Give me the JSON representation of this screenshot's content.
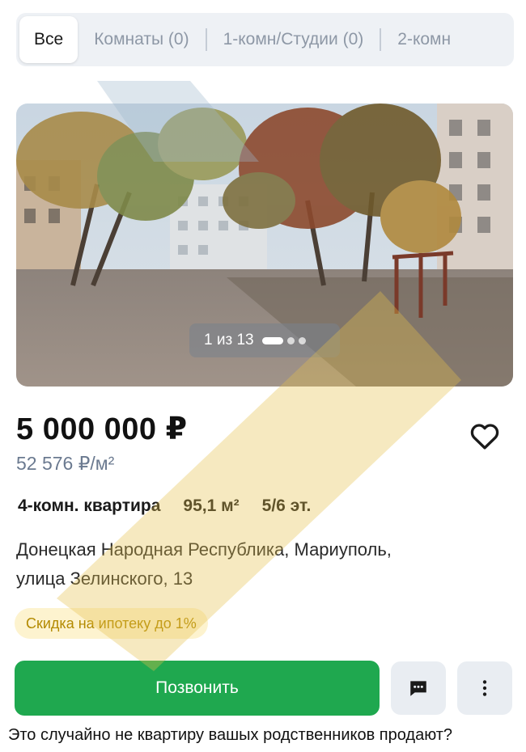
{
  "tabs": [
    {
      "label": "Все",
      "active": true
    },
    {
      "label": "Комнаты (0)",
      "active": false
    },
    {
      "label": "1-комн/Студии (0)",
      "active": false
    },
    {
      "label": "2-комн",
      "active": false
    }
  ],
  "photo": {
    "counter": "1 из 13",
    "dots_total": 3,
    "active_dot": 1
  },
  "listing": {
    "price": "5 000 000 ₽",
    "price_per_m": "52 576 ₽/м²",
    "rooms": "4-комн. квартира",
    "area": "95,1 м²",
    "floor": "5/6 эт.",
    "address_line1": "Донецкая Народная Республика, Мариуполь,",
    "address_line2": "улица Зелинского, 13",
    "badge": "Скидка на ипотеку до 1%"
  },
  "actions": {
    "call_label": "Позвонить",
    "chat_icon": "chat-bubble-icon",
    "more_icon": "more-vertical-icon",
    "favorite_icon": "heart-icon"
  },
  "caption": "Это случайно не квартиру вашых родственников продают?",
  "colors": {
    "accent_green": "#1fa84f",
    "badge_bg": "#fdf3cf",
    "badge_text": "#b38a00",
    "muted_text": "#6b7a90"
  }
}
